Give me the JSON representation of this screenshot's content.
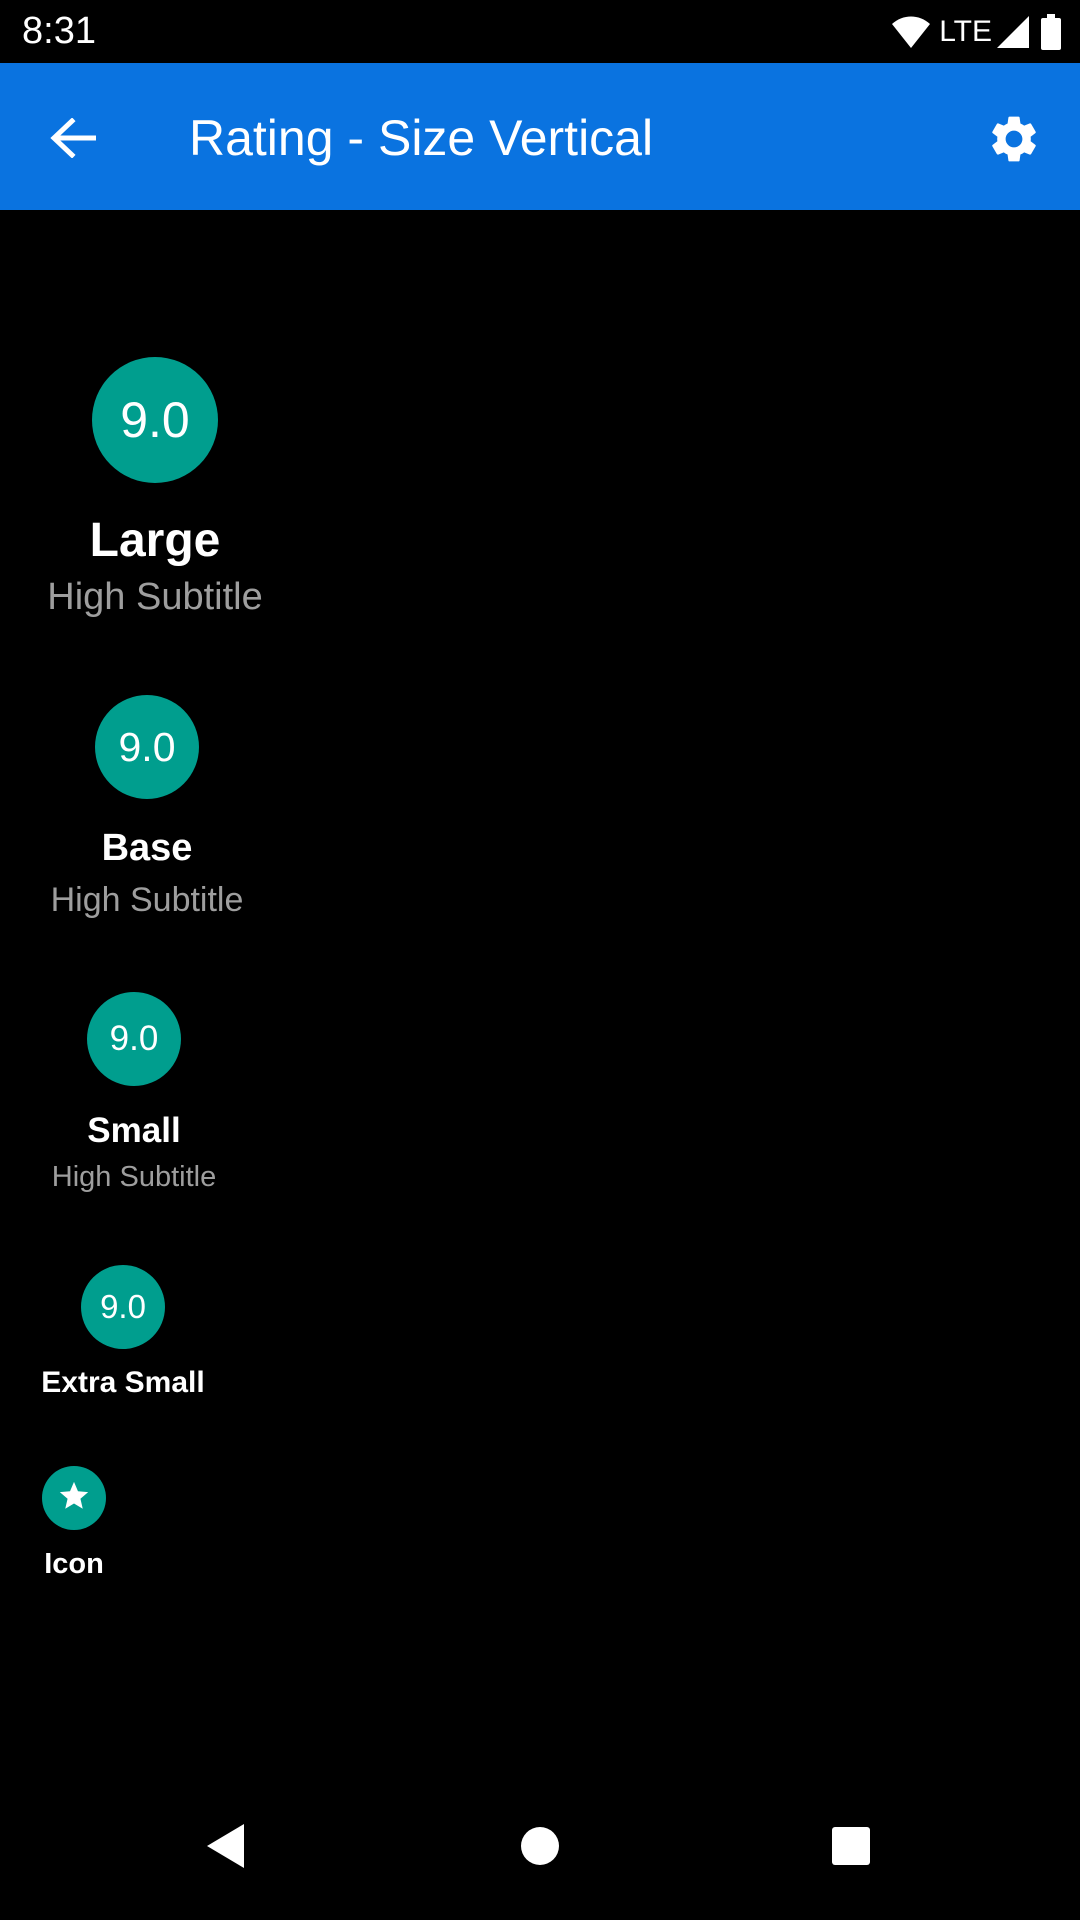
{
  "status_bar": {
    "time": "8:31",
    "network": "LTE",
    "icons": [
      "wifi-icon",
      "cell-signal-icon",
      "battery-icon"
    ]
  },
  "app_bar": {
    "title": "Rating - Size Vertical",
    "background_color": "#0a73e0",
    "back_icon": "arrow-back-icon",
    "settings_icon": "gear-icon"
  },
  "accent_color": "#009e8e",
  "ratings": [
    {
      "size": "large",
      "value": "9.0",
      "title": "Large",
      "subtitle": "High Subtitle"
    },
    {
      "size": "base",
      "value": "9.0",
      "title": "Base",
      "subtitle": "High Subtitle"
    },
    {
      "size": "small",
      "value": "9.0",
      "title": "Small",
      "subtitle": "High Subtitle"
    },
    {
      "size": "extra-small",
      "value": "9.0",
      "title": "Extra Small"
    },
    {
      "size": "icon",
      "icon": "star-icon",
      "title": "Icon"
    }
  ],
  "nav_bar": {
    "icons": [
      "nav-back-icon",
      "nav-home-icon",
      "nav-recents-icon"
    ]
  }
}
